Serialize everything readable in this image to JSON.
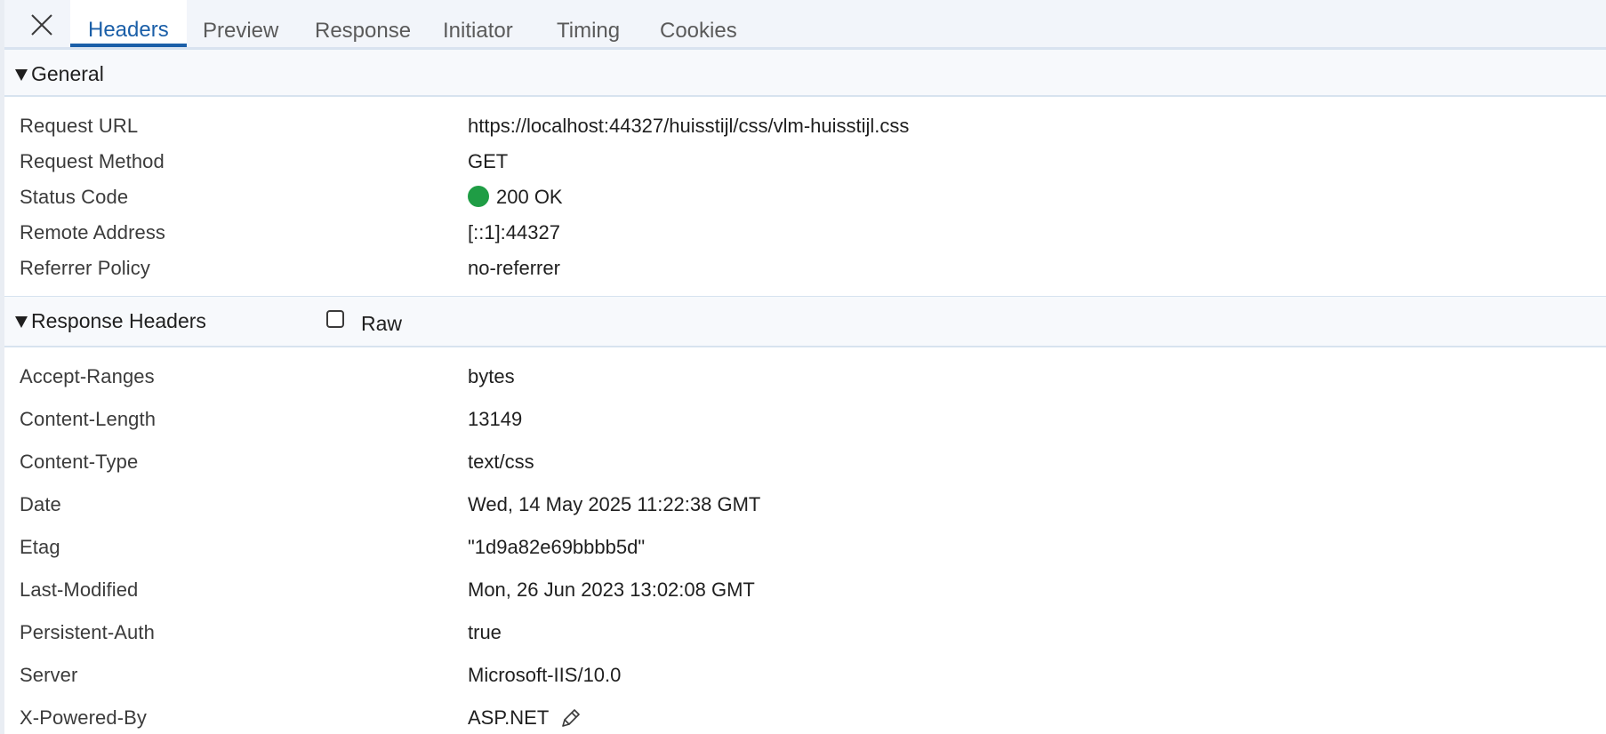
{
  "tabs": [
    {
      "label": "Headers",
      "active": true
    },
    {
      "label": "Preview",
      "active": false
    },
    {
      "label": "Response",
      "active": false
    },
    {
      "label": "Initiator",
      "active": false
    },
    {
      "label": "Timing",
      "active": false
    },
    {
      "label": "Cookies",
      "active": false
    }
  ],
  "general": {
    "title": "General",
    "rows": [
      {
        "key": "Request URL",
        "value": "https://localhost:44327/huisstijl/css/vlm-huisstijl.css"
      },
      {
        "key": "Request Method",
        "value": "GET"
      },
      {
        "key": "Status Code",
        "value": "200 OK"
      },
      {
        "key": "Remote Address",
        "value": "[::1]:44327"
      },
      {
        "key": "Referrer Policy",
        "value": "no-referrer"
      }
    ]
  },
  "response_headers": {
    "title": "Response Headers",
    "raw_label": "Raw",
    "raw_checked": false,
    "rows": [
      {
        "key": "Accept-Ranges",
        "value": "bytes"
      },
      {
        "key": "Content-Length",
        "value": "13149"
      },
      {
        "key": "Content-Type",
        "value": "text/css"
      },
      {
        "key": "Date",
        "value": "Wed, 14 May 2025 11:22:38 GMT"
      },
      {
        "key": "Etag",
        "value": "\"1d9a82e69bbbb5d\""
      },
      {
        "key": "Last-Modified",
        "value": "Mon, 26 Jun 2023 13:02:08 GMT"
      },
      {
        "key": "Persistent-Auth",
        "value": "true"
      },
      {
        "key": "Server",
        "value": "Microsoft-IIS/10.0"
      },
      {
        "key": "X-Powered-By",
        "value": "ASP.NET"
      }
    ]
  },
  "colors": {
    "accent": "#1b5fa8",
    "status_ok": "#1f9d45"
  },
  "icons": {
    "close": "close-icon",
    "expand": "triangle-down-icon",
    "edit": "pencil-icon",
    "status": "status-dot-icon"
  }
}
